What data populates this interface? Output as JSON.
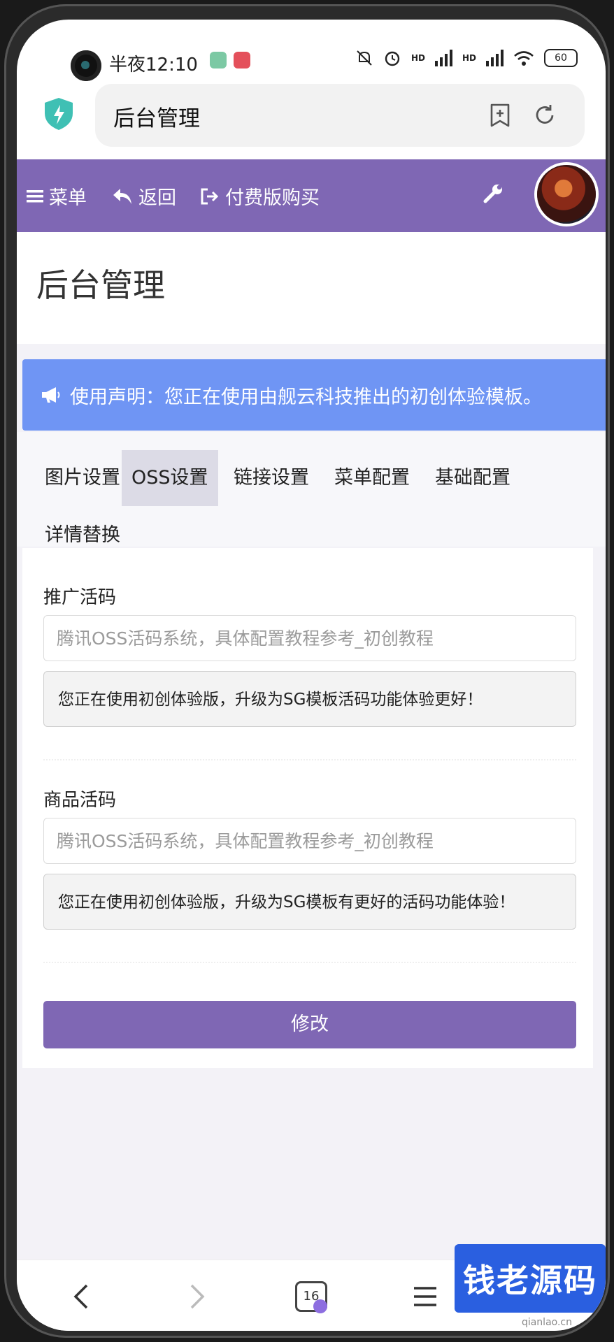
{
  "status": {
    "time": "半夜12:10",
    "battery": "60",
    "hd1": "HD",
    "hd2": "HD"
  },
  "browser": {
    "address_title": "后台管理"
  },
  "nav": {
    "menu": "菜单",
    "back": "返回",
    "buy": "付费版购买"
  },
  "page": {
    "title": "后台管理"
  },
  "notice": "使用声明：您正在使用由舰云科技推出的初创体验模板。",
  "tabs": [
    {
      "label": "图片设置",
      "active": false
    },
    {
      "label": "OSS设置",
      "active": true
    },
    {
      "label": "链接设置",
      "active": false
    },
    {
      "label": "菜单配置",
      "active": false
    },
    {
      "label": "基础配置",
      "active": false
    },
    {
      "label": "详情替换",
      "active": false
    }
  ],
  "form": {
    "promo": {
      "label": "推广活码",
      "placeholder": "腾讯OSS活码系统，具体配置教程参考_初创教程",
      "note": "您正在使用初创体验版，升级为SG模板活码功能体验更好！"
    },
    "product": {
      "label": "商品活码",
      "placeholder": "腾讯OSS活码系统，具体配置教程参考_初创教程",
      "note": "您正在使用初创体验版，升级为SG模板有更好的活码功能体验！"
    },
    "submit": "修改"
  },
  "bottom": {
    "tab_count": "16"
  },
  "watermark": {
    "title": "钱老源码",
    "url": "qianlao.cn"
  },
  "colors": {
    "accent": "#7f67b4",
    "notice": "#6f95f4"
  }
}
